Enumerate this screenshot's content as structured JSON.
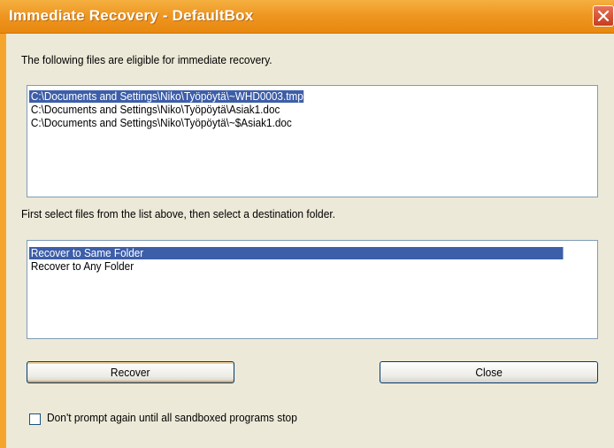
{
  "window": {
    "title": "Immediate Recovery - DefaultBox"
  },
  "intro_text": "The following files are eligible for immediate recovery.",
  "files": [
    "C:\\Documents and Settings\\Niko\\Työpöytä\\~WHD0003.tmp",
    "C:\\Documents and Settings\\Niko\\Työpöytä\\Asiak1.doc",
    "C:\\Documents and Settings\\Niko\\Työpöytä\\~$Asiak1.doc"
  ],
  "selected_file_index": 0,
  "instruction_text": "First select files from the list above, then select a destination folder.",
  "destinations": [
    "Recover to Same Folder",
    "Recover to Any Folder"
  ],
  "selected_destination_index": 0,
  "buttons": {
    "recover": "Recover",
    "close": "Close"
  },
  "checkbox": {
    "label": "Don't prompt again until all sandboxed programs stop",
    "checked": false
  },
  "colors": {
    "titlebar": "#ee9520",
    "selection": "#3d5ea8",
    "dialog_bg": "#ece9d8"
  }
}
